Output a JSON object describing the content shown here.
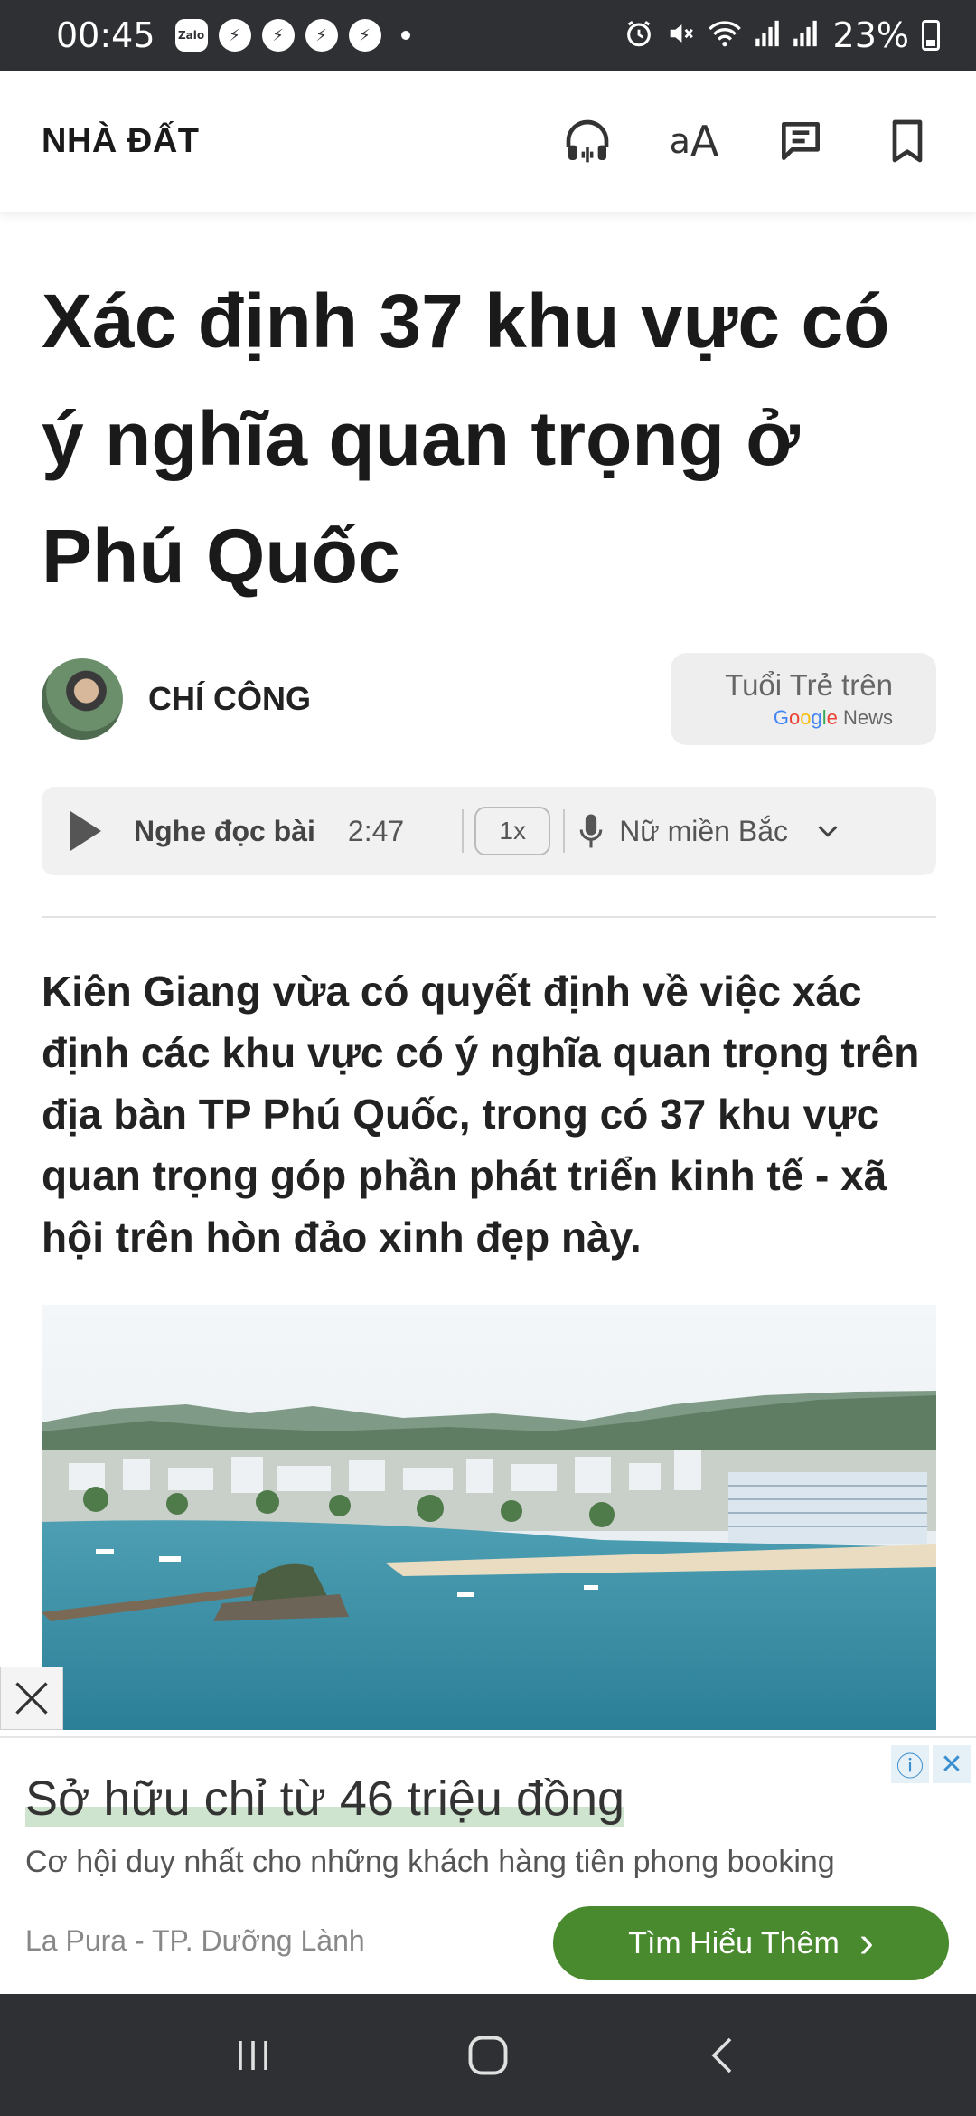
{
  "status_bar": {
    "time": "00:45",
    "app_chip": "Zalo",
    "battery": "23%",
    "icons": [
      "zalo-icon",
      "messenger-icon",
      "messenger-icon",
      "messenger-icon",
      "messenger-icon",
      "alarm-icon",
      "mute-icon",
      "wifi-icon",
      "signal-icon",
      "signal-icon",
      "battery-icon"
    ]
  },
  "header": {
    "section": "NHÀ ĐẤT",
    "font_icon_small": "a",
    "font_icon_large": "A",
    "icons": [
      "headphones-icon",
      "font-size-icon",
      "comment-icon",
      "bookmark-icon"
    ]
  },
  "article": {
    "title": "Xác định 37 khu vực có ý nghĩa quan trọng ở Phú Quốc",
    "author": "CHÍ CÔNG",
    "gnews": {
      "label": "Tuổi Trẻ trên",
      "brand_g1": "G",
      "brand_g2": "o",
      "brand_g3": "o",
      "brand_g4": "g",
      "brand_g5": "l",
      "brand_g6": "e",
      "brand_news": "News"
    },
    "player": {
      "label": "Nghe đọc bài",
      "duration": "2:47",
      "speed": "1x",
      "voice": "Nữ miền Bắc"
    },
    "sapo": "Kiên Giang vừa có quyết định về việc xác định các khu vực có ý nghĩa quan trọng trên địa bàn TP Phú Quốc, trong có 37 khu vực quan trọng góp phần phát triển kinh tế - xã hội trên hòn đảo xinh đẹp này."
  },
  "ad": {
    "title": "Sở hữu chỉ từ 46 triệu đồng",
    "body": "Cơ hội duy nhất cho những khách hàng tiên phong booking",
    "source": "La Pura - TP. Dưỡng Lành",
    "cta": "Tìm Hiểu Thêm",
    "cta_arrow": "›",
    "info_symbol": "ⓘ",
    "close_symbol": "✕"
  },
  "colors": {
    "status_bg": "#2f3034",
    "cta_green": "#4a8a2f",
    "ad_highlight": "#cfe4cf"
  }
}
